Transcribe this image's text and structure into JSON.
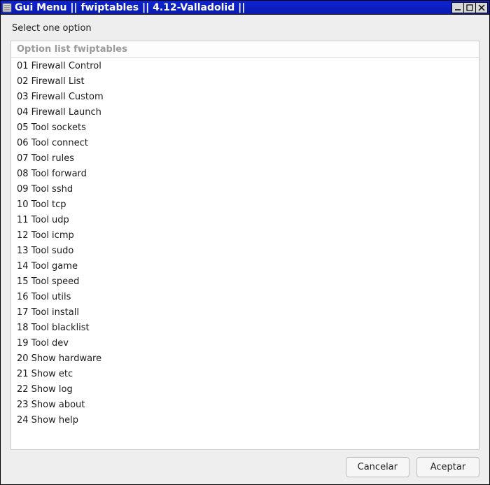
{
  "window": {
    "title": "Gui Menu || fwiptables || 4.12-Valladolid ||"
  },
  "dialog": {
    "prompt": "Select one option",
    "list_header": "Option list fwiptables",
    "options": [
      "01 Firewall Control",
      "02 Firewall List",
      "03 Firewall Custom",
      "04 Firewall Launch",
      "05 Tool sockets",
      "06 Tool connect",
      "07 Tool rules",
      "08 Tool forward",
      "09 Tool sshd",
      "10 Tool tcp",
      "11 Tool udp",
      "12 Tool icmp",
      "13 Tool sudo",
      "14 Tool game",
      "15 Tool speed",
      "16 Tool utils",
      "17 Tool install",
      "18 Tool blacklist",
      "19 Tool dev",
      "20 Show hardware",
      "21 Show etc",
      "22 Show log",
      "23 Show about",
      "24 Show help"
    ],
    "buttons": {
      "cancel": "Cancelar",
      "accept": "Aceptar"
    }
  }
}
